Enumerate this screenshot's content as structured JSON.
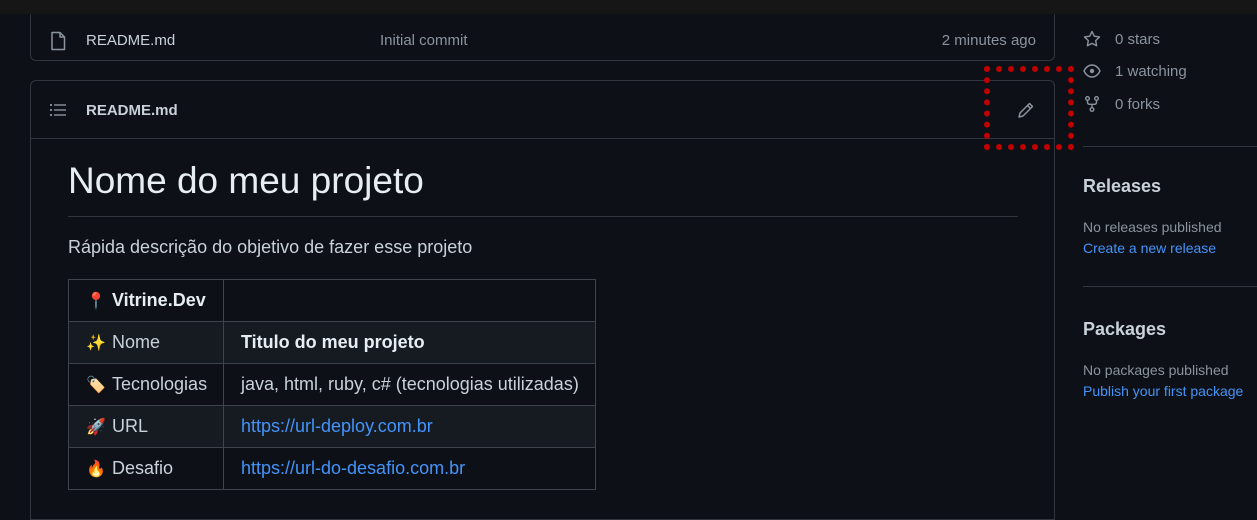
{
  "file_row": {
    "name": "README.md",
    "commit_message": "Initial commit",
    "time": "2 minutes ago"
  },
  "readme": {
    "title": "README.md",
    "heading": "Nome do meu projeto",
    "description": "Rápida descrição do objetivo de fazer esse projeto",
    "table": [
      {
        "emoji": "📍",
        "label": "Vitrine.Dev",
        "value": "",
        "label_bold": true
      },
      {
        "emoji": "✨",
        "label": "Nome",
        "value": "Titulo do meu projeto",
        "value_bold": true
      },
      {
        "emoji": "🏷️",
        "label": "Tecnologias",
        "value": "java, html, ruby, c# (tecnologias utilizadas)"
      },
      {
        "emoji": "🚀",
        "label": "URL",
        "value": "https://url-deploy.com.br",
        "value_link": true
      },
      {
        "emoji": "🔥",
        "label": "Desafio",
        "value": "https://url-do-desafio.com.br",
        "value_link": true
      }
    ]
  },
  "sidebar": {
    "stars": "0 stars",
    "watching": "1 watching",
    "forks": "0 forks",
    "releases": {
      "heading": "Releases",
      "note": "No releases published",
      "link": "Create a new release"
    },
    "packages": {
      "heading": "Packages",
      "note": "No packages published",
      "link": "Publish your first package"
    }
  },
  "colors": {
    "background": "#0d1117",
    "border": "#30363d",
    "link": "#4493f8",
    "highlight": "#c00000"
  },
  "icons": [
    "file-icon",
    "list-icon",
    "pencil-icon",
    "star-icon",
    "eye-icon",
    "fork-icon"
  ]
}
